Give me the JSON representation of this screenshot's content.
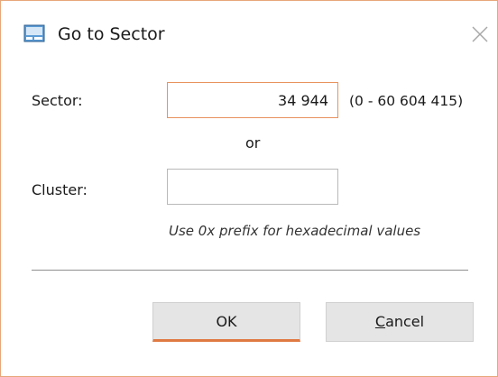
{
  "window": {
    "title": "Go to Sector",
    "accent_color": "#e8935e",
    "icon": "drive-window-icon",
    "close_icon": "close-icon"
  },
  "form": {
    "sector_label": "Sector:",
    "sector_value": "34 944",
    "sector_range": "(0 - 60 604 415)",
    "or_text": "or",
    "cluster_label": "Cluster:",
    "cluster_value": "",
    "hint": "Use 0x prefix for hexadecimal values"
  },
  "buttons": {
    "ok_label": "OK",
    "cancel_first": "C",
    "cancel_rest": "ancel"
  }
}
